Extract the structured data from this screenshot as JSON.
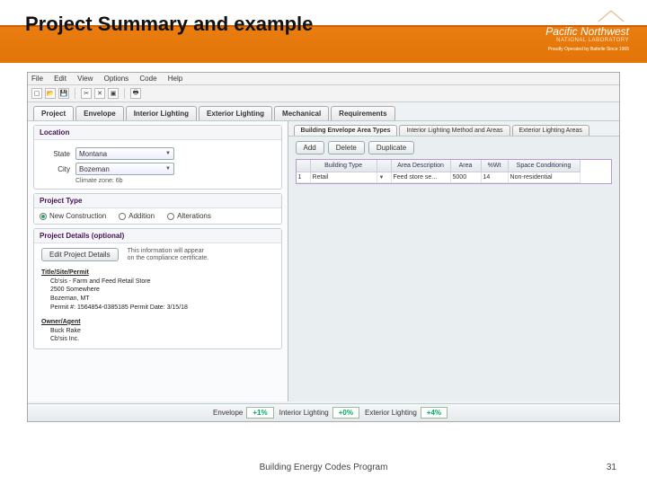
{
  "slide": {
    "title": "Project Summary and example",
    "brand_name": "Pacific Northwest",
    "brand_sub": "NATIONAL LABORATORY",
    "brand_tag": "Proudly Operated by Battelle Since 1965",
    "footer": "Building Energy Codes Program",
    "page": "31"
  },
  "menu": {
    "items": [
      "File",
      "Edit",
      "View",
      "Options",
      "Code",
      "Help"
    ]
  },
  "tabs": {
    "items": [
      "Project",
      "Envelope",
      "Interior Lighting",
      "Exterior Lighting",
      "Mechanical",
      "Requirements"
    ],
    "active": 0
  },
  "location": {
    "title": "Location",
    "state_label": "State",
    "state_value": "Montana",
    "city_label": "City",
    "city_value": "Bozeman",
    "climate": "Climate zone: 6b"
  },
  "project_type": {
    "title": "Project Type",
    "options": [
      "New Construction",
      "Addition",
      "Alterations"
    ],
    "selected": 0
  },
  "project_details": {
    "title": "Project Details (optional)",
    "edit_btn": "Edit Project Details",
    "info1": "This information will appear",
    "info2": "on the compliance certificate.",
    "heading1": "Title/Site/Permit",
    "lines1": [
      "Cb'sis - Farm and Feed Retail Store",
      "2500 Somewhere",
      "Bozeman, MT",
      "Permit #: 1564854-0385185   Permit Date: 3/15/18"
    ],
    "heading2": "Owner/Agent",
    "lines2": [
      "Buck Rake",
      "Cb'sis Inc."
    ]
  },
  "sub_tabs": {
    "items": [
      "Building Envelope Area Types",
      "Interior Lighting Method and Areas",
      "Exterior Lighting Areas"
    ],
    "active": 0
  },
  "actions": {
    "add": "Add",
    "delete": "Delete",
    "duplicate": "Duplicate"
  },
  "table": {
    "headers": [
      "",
      "Building Type",
      "",
      "Area Description",
      "Area",
      "%Wt",
      "Space Conditioning"
    ],
    "rows": [
      {
        "n": "1",
        "type": "Retail",
        "desc": "Feed store se...",
        "area": "5000",
        "wt": "14",
        "cond": "Non-residential"
      }
    ]
  },
  "status": {
    "items": [
      {
        "label": "Envelope",
        "value": "+1%"
      },
      {
        "label": "Interior Lighting",
        "value": "+0%"
      },
      {
        "label": "Exterior Lighting",
        "value": "+4%"
      }
    ]
  }
}
